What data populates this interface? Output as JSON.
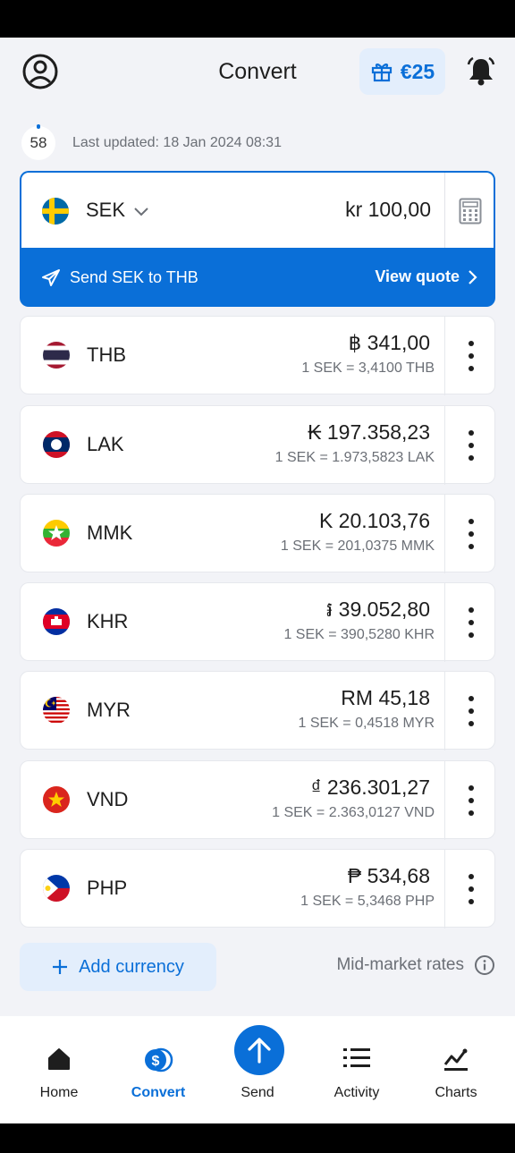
{
  "header": {
    "title": "Convert",
    "promo_amount": "€25"
  },
  "status": {
    "countdown": "58",
    "last_updated": "Last updated: 18 Jan 2024 08:31"
  },
  "base": {
    "code": "SEK",
    "amount": "kr 100,00",
    "send_label": "Send SEK to THB",
    "quote_label": "View quote"
  },
  "currencies": [
    {
      "code": "THB",
      "amount": "฿ 341,00",
      "rate": "1 SEK = 3,4100 THB"
    },
    {
      "code": "LAK",
      "amount": "₭ 197.358,23",
      "rate": "1 SEK = 1.973,5823 LAK"
    },
    {
      "code": "MMK",
      "amount": "K 20.103,76",
      "rate": "1 SEK = 201,0375 MMK"
    },
    {
      "code": "KHR",
      "amount": "៛ 39.052,80",
      "rate": "1 SEK = 390,5280 KHR"
    },
    {
      "code": "MYR",
      "amount": "RM 45,18",
      "rate": "1 SEK = 0,4518 MYR"
    },
    {
      "code": "VND",
      "amount": "₫ 236.301,27",
      "rate": "1 SEK = 2.363,0127 VND"
    },
    {
      "code": "PHP",
      "amount": "₱ 534,68",
      "rate": "1 SEK = 5,3468 PHP"
    }
  ],
  "footer": {
    "add_label": "Add currency",
    "mid_market": "Mid-market rates"
  },
  "nav": [
    {
      "label": "Home",
      "icon": "home-icon"
    },
    {
      "label": "Convert",
      "icon": "convert-icon"
    },
    {
      "label": "Send",
      "icon": "send-arrow-icon"
    },
    {
      "label": "Activity",
      "icon": "list-icon"
    },
    {
      "label": "Charts",
      "icon": "chart-icon"
    }
  ],
  "colors": {
    "accent": "#0a6fd8",
    "background": "#f2f3f7",
    "text": "#1e1e1e",
    "muted": "#6b6f76"
  }
}
